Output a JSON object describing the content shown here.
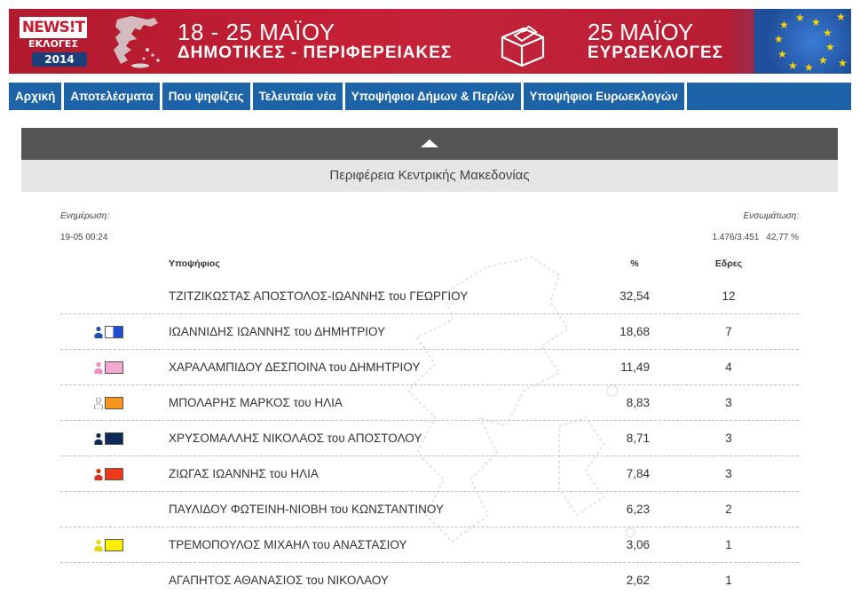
{
  "banner": {
    "logo_news": "NEWS!T",
    "logo_elections": "ΕΚΛΟΓΕΣ",
    "logo_year": "2014",
    "local_dates": "18 - 25 ΜΑΪΟΥ",
    "local_sub": "ΔΗΜΟΤΙΚΕΣ - ΠΕΡΙΦΕΡΕΙΑΚΕΣ",
    "euro_date": "25 ΜΑΪΟΥ",
    "euro_sub": "ΕΥΡΩΕΚΛΟΓΕΣ"
  },
  "nav": {
    "items": [
      {
        "label": "Αρχική"
      },
      {
        "label": "Αποτελέσματα"
      },
      {
        "label": "Που ψηφίζεις"
      },
      {
        "label": "Τελευταία νέα"
      },
      {
        "label": "Υποψήφιοι Δήμων & Περ/ών"
      },
      {
        "label": "Υποψήφιοι Ευρωεκλογών"
      }
    ]
  },
  "panel": {
    "region": "Περιφέρεια Κεντρικής Μακεδονίας",
    "updated_label": "Ενημέρωση:",
    "updated_value": "19-05 00:24",
    "counted_label": "Ενσωμάτωση:",
    "counted_value": "1.476/3.451",
    "counted_percent": "42,77 %"
  },
  "table": {
    "headers": {
      "candidate": "Υποψήφιος",
      "percent": "%",
      "seats": "Εδρες"
    },
    "rows": [
      {
        "name": "ΤΖΙΤΖΙΚΩΣΤΑΣ ΑΠΟΣΤΟΛΟΣ-ΙΩΑΝΝΗΣ του ΓΕΩΡΓΙΟΥ",
        "percent": "32,54",
        "seats": "12",
        "color": "",
        "person_color": "",
        "icon": "none"
      },
      {
        "name": "ΙΩΑΝΝΙΔΗΣ ΙΩΑΝΝΗΣ του ΔΗΜΗΤΡΙΟΥ",
        "percent": "18,68",
        "seats": "7",
        "color": "#1f4fd0",
        "person_color": "#1f4fb0",
        "icon": "party-blue-white"
      },
      {
        "name": "ΧΑΡΑΛΑΜΠΙΔΟΥ ΔΕΣΠΟΙΝΑ του ΔΗΜΗΤΡΙΟΥ",
        "percent": "11,49",
        "seats": "4",
        "color": "#f5a8cf",
        "person_color": "#f08cc0",
        "icon": "party-pink"
      },
      {
        "name": "ΜΠΟΛΑΡΗΣ ΜΑΡΚΟΣ του ΗΛΙΑ",
        "percent": "8,83",
        "seats": "3",
        "color": "#f7941d",
        "person_color": "#ffffff",
        "icon": "party-orange"
      },
      {
        "name": "ΧΡΥΣΟΜΑΛΛΗΣ ΝΙΚΟΛΑΟΣ του ΑΠΟΣΤΟΛΟΥ",
        "percent": "8,71",
        "seats": "3",
        "color": "#0f2a55",
        "person_color": "#0f2a55",
        "icon": "party-navy"
      },
      {
        "name": "ΖΙΩΓΑΣ ΙΩΑΝΝΗΣ του ΗΛΙΑ",
        "percent": "7,84",
        "seats": "3",
        "color": "#ee3a1a",
        "person_color": "#e0301a",
        "icon": "party-red"
      },
      {
        "name": "ΠΑΥΛΙΔΟΥ ΦΩΤΕΙΝΗ-ΝΙΟΒΗ του ΚΩΝΣΤΑΝΤΙΝΟΥ",
        "percent": "6,23",
        "seats": "2",
        "color": "",
        "person_color": "",
        "icon": "none"
      },
      {
        "name": "ΤΡΕΜΟΠΟΥΛΟΣ ΜΙΧΑΗΛ του ΑΝΑΣΤΑΣΙΟΥ",
        "percent": "3,06",
        "seats": "1",
        "color": "#ffef00",
        "person_color": "#e8d800",
        "icon": "party-yellow"
      },
      {
        "name": "ΑΓΑΠΗΤΟΣ ΑΘΑΝΑΣΙΟΣ του ΝΙΚΟΛΑΟΥ",
        "percent": "2,62",
        "seats": "1",
        "color": "",
        "person_color": "",
        "icon": "none"
      }
    ]
  }
}
